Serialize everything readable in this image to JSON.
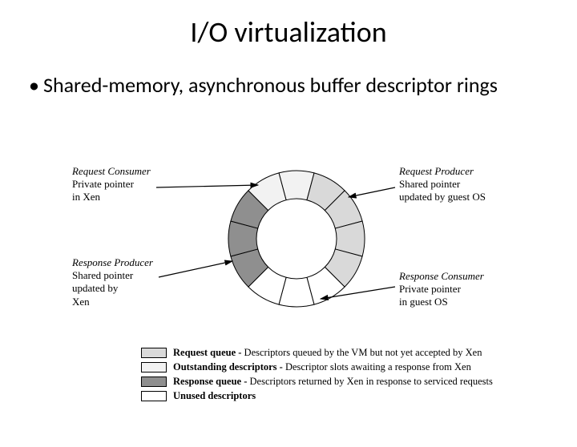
{
  "title": "I/O virtualization",
  "bullet_text": "Shared-memory, asynchronous buffer descriptor rings",
  "labels": {
    "req_consumer_title": "Request Consumer",
    "req_consumer_sub": "Private pointer\nin Xen",
    "req_producer_title": "Request Producer",
    "req_producer_sub": "Shared pointer\nupdated by guest OS",
    "resp_producer_title": "Response Producer",
    "resp_producer_sub": "Shared pointer\nupdated by\nXen",
    "resp_consumer_title": "Response Consumer",
    "resp_consumer_sub": "Private pointer\nin guest OS"
  },
  "legend": [
    {
      "color": "#d9d9d9",
      "bold": "Request queue -",
      "rest": " Descriptors queued by the VM but not yet accepted by Xen"
    },
    {
      "color": "#f2f2f2",
      "bold": "Outstanding descriptors -",
      "rest": " Descriptor slots awaiting a response from Xen"
    },
    {
      "color": "#8f8f8f",
      "bold": "Response queue -",
      "rest": " Descriptors returned by Xen in response to serviced requests"
    },
    {
      "color": "#ffffff",
      "bold": "Unused descriptors",
      "rest": ""
    }
  ],
  "chart_data": {
    "type": "pie",
    "title": "Asynchronous I/O descriptor ring",
    "categories": [
      "Request queue",
      "Outstanding descriptors",
      "Response queue",
      "Unused descriptors"
    ],
    "values": [
      4,
      2,
      3,
      3
    ],
    "series": [
      {
        "name": "Segment colors",
        "values": [
          "#d9d9d9",
          "#f2f2f2",
          "#8f8f8f",
          "#ffffff"
        ]
      }
    ],
    "pointers": [
      {
        "name": "Request Producer",
        "between_segments": "Request queue → Unused descriptors",
        "owner": "guest OS",
        "shared": true
      },
      {
        "name": "Request Consumer",
        "between_segments": "Outstanding descriptors → Request queue",
        "owner": "Xen",
        "shared": false
      },
      {
        "name": "Response Producer",
        "between_segments": "Response queue → Outstanding descriptors",
        "owner": "Xen",
        "shared": true
      },
      {
        "name": "Response Consumer",
        "between_segments": "Unused descriptors → Response queue",
        "owner": "guest OS",
        "shared": false
      }
    ]
  }
}
